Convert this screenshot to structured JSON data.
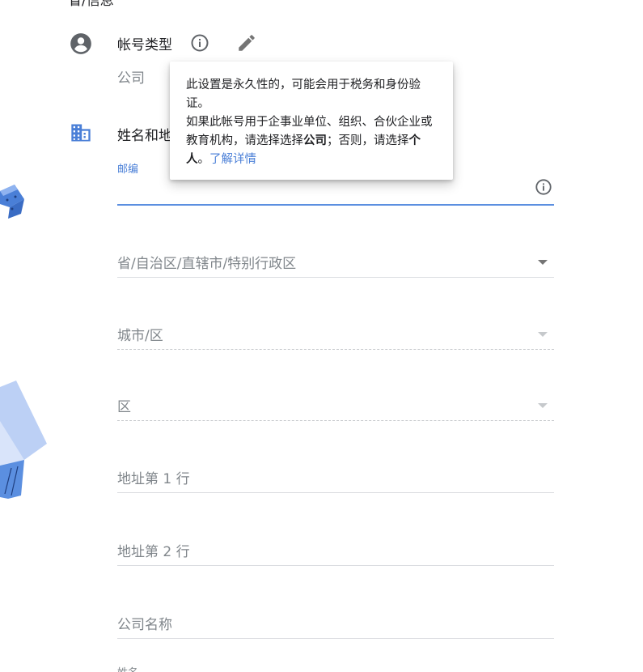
{
  "section_header": "省/信息",
  "account_type": {
    "icon": "account-circle-icon",
    "title": "帐号类型",
    "info_icon": "info-icon",
    "edit_icon": "pencil-icon",
    "value": "公司"
  },
  "tooltip": {
    "line1": "此设置是永久性的，可能会用于税务和身份验证。",
    "line2_before": "如果此帐号用于企事业单位、组织、合伙企业或教育机构，请选择选择",
    "line2_bold1": "公司",
    "line2_middle": "；否则，请选择",
    "line2_bold2": "个人",
    "line2_end": "。",
    "link": "了解详情"
  },
  "name_address": {
    "icon": "building-icon",
    "title": "姓名和地",
    "zip_label": "邮编",
    "zip_info_icon": "info-icon"
  },
  "fields": {
    "province": "省/自治区/直辖市/特别行政区",
    "city": "城市/区",
    "district": "区",
    "address1": "地址第 1 行",
    "address2": "地址第 2 行",
    "company": "公司名称",
    "next_label": "姓名"
  },
  "colors": {
    "accent": "#4a7fd7",
    "icon_gray": "#5f6368",
    "placeholder": "#80868b"
  }
}
